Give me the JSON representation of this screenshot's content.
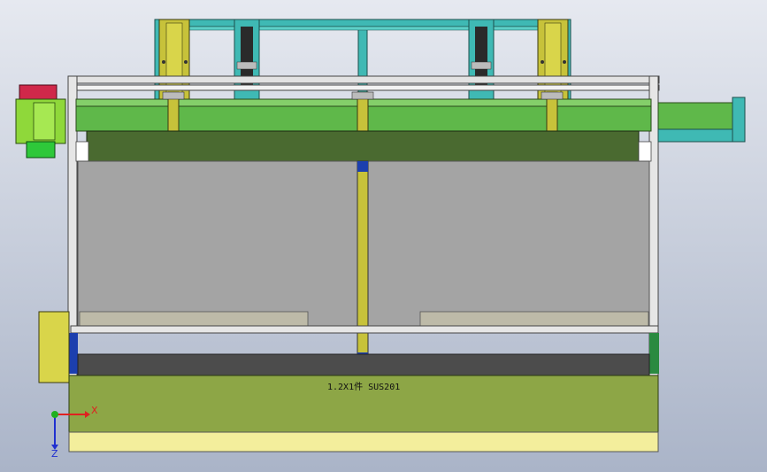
{
  "viewport": {
    "background_top": "#e6e9f0",
    "background_bottom": "#aab4c8"
  },
  "annotation": {
    "plate_label": "1.2X1件 SUS201"
  },
  "triad": {
    "x_label": "X",
    "z_label": "Z",
    "x_color": "#e02020",
    "y_color": "#20b020",
    "z_color": "#2030d0"
  },
  "colors": {
    "frame_teal": "#3fb9b4",
    "beam_green": "#5fb84a",
    "beam_dark": "#4a6a30",
    "panel_gray": "#a4a4a4",
    "plate_olive": "#8da646",
    "base_yellow": "#f3ee9c",
    "motor_lime": "#8fd83a",
    "motor_red": "#d0284a",
    "column_yellow": "#c7c23a"
  }
}
